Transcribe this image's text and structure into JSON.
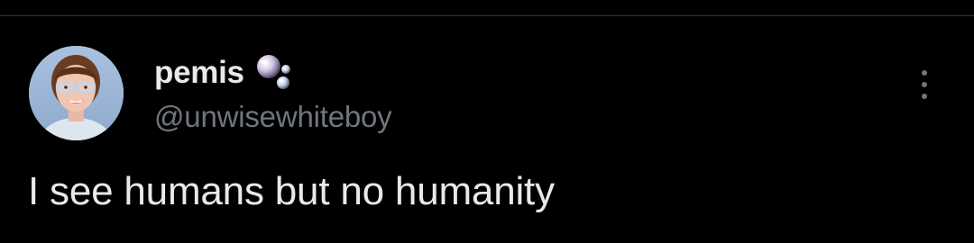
{
  "colors": {
    "background": "#000000",
    "divider": "#2f3336",
    "primary_text": "#e7e9ea",
    "secondary_text": "#71767b"
  },
  "author": {
    "display_name": "pemis",
    "badge_icon": "soap-bubbles-icon",
    "handle": "@unwisewhiteboy",
    "avatar_icon": "profile-avatar"
  },
  "actions": {
    "more_icon": "more-options-vertical-icon"
  },
  "tweet": {
    "text": "I see humans but no humanity"
  }
}
